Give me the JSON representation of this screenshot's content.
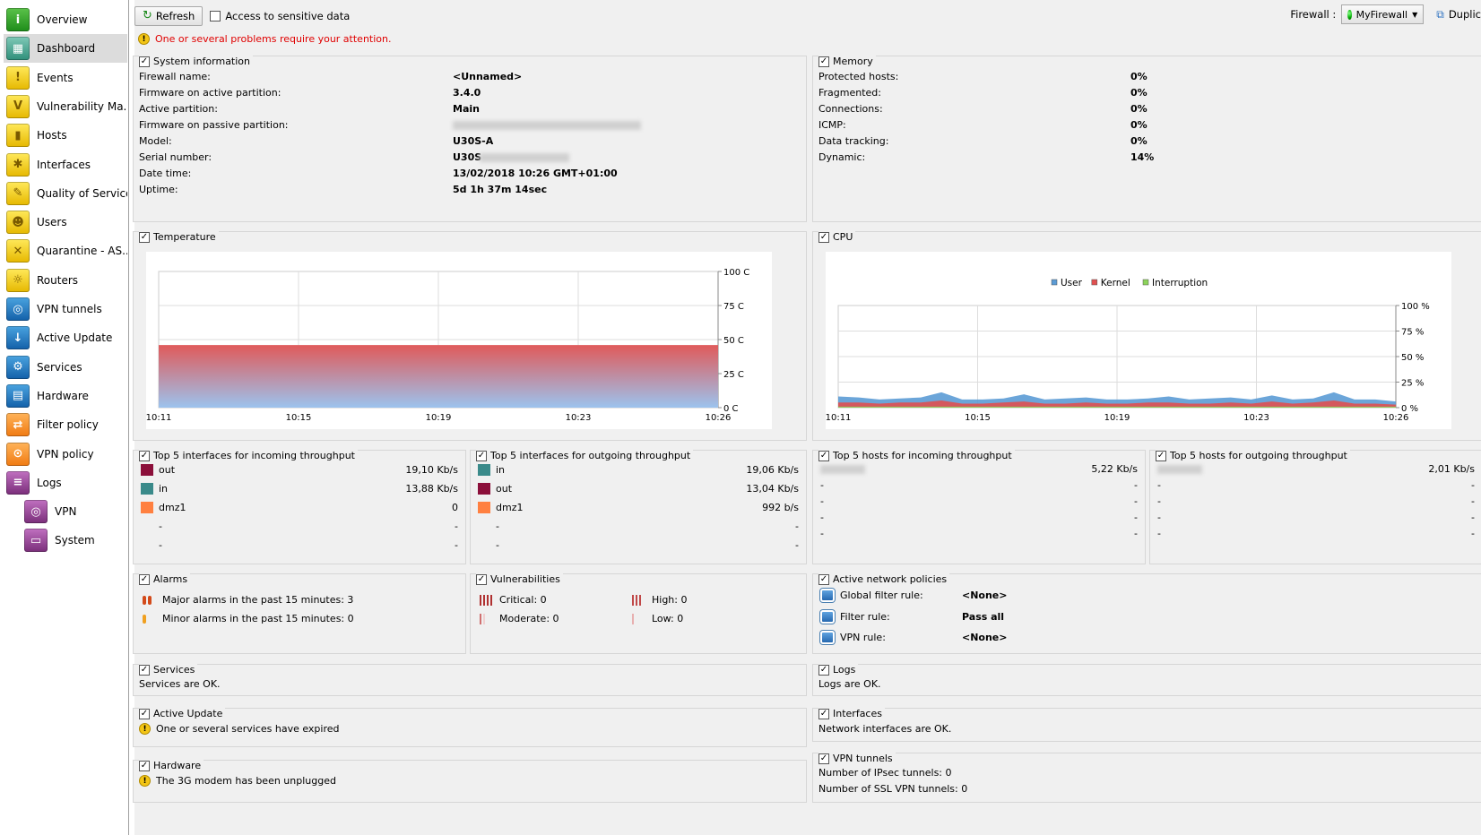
{
  "sidebar": {
    "items": [
      {
        "label": "Overview",
        "icon": "info-icon",
        "color": "green"
      },
      {
        "label": "Dashboard",
        "icon": "dashboard-icon",
        "color": "teal",
        "active": true
      },
      {
        "label": "Events",
        "icon": "warning-icon",
        "color": "yellow"
      },
      {
        "label": "Vulnerability Ma...",
        "icon": "shield-icon",
        "color": "yellow"
      },
      {
        "label": "Hosts",
        "icon": "host-icon",
        "color": "yellow"
      },
      {
        "label": "Interfaces",
        "icon": "interface-icon",
        "color": "yellow"
      },
      {
        "label": "Quality of Service",
        "icon": "qos-icon",
        "color": "yellow"
      },
      {
        "label": "Users",
        "icon": "users-icon",
        "color": "yellow"
      },
      {
        "label": "Quarantine - AS...",
        "icon": "quarantine-icon",
        "color": "yellow"
      },
      {
        "label": "Routers",
        "icon": "router-icon",
        "color": "yellow"
      },
      {
        "label": "VPN tunnels",
        "icon": "vpn-icon",
        "color": "blue"
      },
      {
        "label": "Active Update",
        "icon": "update-icon",
        "color": "blue"
      },
      {
        "label": "Services",
        "icon": "gear-icon",
        "color": "blue"
      },
      {
        "label": "Hardware",
        "icon": "hardware-icon",
        "color": "blue"
      },
      {
        "label": "Filter policy",
        "icon": "filter-icon",
        "color": "orange"
      },
      {
        "label": "VPN policy",
        "icon": "vpn-policy-icon",
        "color": "orange"
      },
      {
        "label": "Logs",
        "icon": "logs-icon",
        "color": "purple"
      },
      {
        "label": "VPN",
        "icon": "vpn-log-icon",
        "color": "purple",
        "sub": true
      },
      {
        "label": "System",
        "icon": "system-log-icon",
        "color": "purple",
        "sub": true
      }
    ]
  },
  "toolbar": {
    "refresh": "Refresh",
    "sensitive": "Access to sensitive data",
    "firewall_label": "Firewall :",
    "firewall_value": "MyFirewall",
    "duplicate": "Duplic"
  },
  "alert": "One or several problems require your attention.",
  "sysinfo": {
    "title": "System information",
    "rows": [
      {
        "k": "Firewall name:",
        "v": "<Unnamed>"
      },
      {
        "k": "Firmware on active partition:",
        "v": "3.4.0"
      },
      {
        "k": "Active partition:",
        "v": "Main"
      },
      {
        "k": "Firmware on passive partition:",
        "v": ""
      },
      {
        "k": "Model:",
        "v": "U30S-A"
      },
      {
        "k": "Serial number:",
        "v": "U30S"
      },
      {
        "k": "Date time:",
        "v": "13/02/2018 10:26 GMT+01:00"
      },
      {
        "k": "Uptime:",
        "v": "5d 1h 37m 14sec"
      }
    ]
  },
  "memory": {
    "title": "Memory",
    "rows": [
      {
        "k": "Protected hosts:",
        "v": "0%"
      },
      {
        "k": "Fragmented:",
        "v": "0%"
      },
      {
        "k": "Connections:",
        "v": "0%"
      },
      {
        "k": "ICMP:",
        "v": "0%"
      },
      {
        "k": "Data tracking:",
        "v": "0%"
      },
      {
        "k": "Dynamic:",
        "v": "14%"
      }
    ]
  },
  "temperature": {
    "title": "Temperature"
  },
  "cpu": {
    "title": "CPU"
  },
  "chart_data": [
    {
      "type": "area",
      "title": "",
      "x": [
        "10:11",
        "10:15",
        "10:19",
        "10:23",
        "10:26"
      ],
      "y_ticks": [
        "100 C",
        "75 C",
        "50 C",
        "25 C",
        "0 C"
      ],
      "ylim": [
        0,
        100
      ],
      "series": [
        {
          "values": [
            46,
            46,
            46,
            46,
            46
          ]
        }
      ]
    },
    {
      "type": "area",
      "title": "",
      "x": [
        "10:11",
        "10:15",
        "10:19",
        "10:23",
        "10:26"
      ],
      "y_ticks": [
        "100 %",
        "75 %",
        "50 %",
        "25 %",
        "0 %"
      ],
      "ylim": [
        0,
        100
      ],
      "legend_position": "top",
      "series": [
        {
          "name": "User",
          "color": "#5b9bd5",
          "values": [
            11,
            10,
            8,
            9,
            10,
            15,
            8,
            8,
            9,
            13,
            8,
            9,
            10,
            8,
            8,
            9,
            11,
            8,
            9,
            10,
            8,
            12,
            8,
            9,
            15,
            8,
            8,
            6
          ]
        },
        {
          "name": "Kernel",
          "color": "#e05050",
          "values": [
            5,
            5,
            4,
            5,
            5,
            7,
            4,
            4,
            5,
            6,
            4,
            4,
            5,
            4,
            4,
            5,
            5,
            4,
            4,
            5,
            4,
            6,
            4,
            5,
            7,
            4,
            4,
            3
          ]
        },
        {
          "name": "Interruption",
          "color": "#8cd35a",
          "values": [
            1,
            1,
            1,
            1,
            1,
            1,
            1,
            1,
            1,
            1,
            1,
            1,
            1,
            1,
            1,
            1,
            1,
            1,
            1,
            1,
            1,
            1,
            1,
            1,
            1,
            1,
            1,
            1
          ]
        }
      ]
    }
  ],
  "tiin": {
    "title": "Top 5 interfaces for incoming throughput",
    "rows": [
      {
        "name": "out",
        "val": "19,10 Kb/s",
        "color": "#8b0f3a"
      },
      {
        "name": "in",
        "val": "13,88 Kb/s",
        "color": "#3a8a8a"
      },
      {
        "name": "dmz1",
        "val": "0",
        "color": "#ff8040"
      },
      {
        "name": "-",
        "val": "-"
      },
      {
        "name": "-",
        "val": "-"
      }
    ]
  },
  "tiout": {
    "title": "Top 5 interfaces for outgoing throughput",
    "rows": [
      {
        "name": "in",
        "val": "19,06 Kb/s",
        "color": "#3a8a8a"
      },
      {
        "name": "out",
        "val": "13,04 Kb/s",
        "color": "#8b0f3a"
      },
      {
        "name": "dmz1",
        "val": "992 b/s",
        "color": "#ff8040"
      },
      {
        "name": "-",
        "val": "-"
      },
      {
        "name": "-",
        "val": "-"
      }
    ]
  },
  "thin": {
    "title": "Top 5 hosts for incoming throughput",
    "rows": [
      {
        "name": "",
        "val": "5,22 Kb/s"
      },
      {
        "name": "-",
        "val": "-"
      },
      {
        "name": "-",
        "val": "-"
      },
      {
        "name": "-",
        "val": "-"
      },
      {
        "name": "-",
        "val": "-"
      }
    ]
  },
  "thout": {
    "title": "Top 5 hosts for outgoing throughput",
    "rows": [
      {
        "name": "",
        "val": "2,01 Kb/s"
      },
      {
        "name": "-",
        "val": "-"
      },
      {
        "name": "-",
        "val": "-"
      },
      {
        "name": "-",
        "val": "-"
      },
      {
        "name": "-",
        "val": "-"
      }
    ]
  },
  "alarms": {
    "title": "Alarms",
    "major": "Major alarms in the past 15 minutes: 3",
    "minor": "Minor alarms in the past 15 minutes: 0"
  },
  "vuln": {
    "title": "Vulnerabilities",
    "critical": "Critical: 0",
    "high": "High: 0",
    "moderate": "Moderate: 0",
    "low": "Low: 0"
  },
  "policies": {
    "title": "Active network policies",
    "rows": [
      {
        "k": "Global filter rule:",
        "v": "<None>"
      },
      {
        "k": "Filter rule:",
        "v": "Pass all"
      },
      {
        "k": "VPN rule:",
        "v": "<None>"
      }
    ]
  },
  "services": {
    "title": "Services",
    "text": "Services are OK."
  },
  "logs": {
    "title": "Logs",
    "text": "Logs are OK."
  },
  "activeupdate": {
    "title": "Active Update",
    "text": "One or several services have expired"
  },
  "interfaces": {
    "title": "Interfaces",
    "text": "Network interfaces are OK."
  },
  "hardware": {
    "title": "Hardware",
    "text": "The 3G modem has been unplugged"
  },
  "vpntunnels": {
    "title": "VPN tunnels",
    "ipsec": "Number of IPsec tunnels: 0",
    "ssl": "Number of SSL VPN tunnels: 0"
  }
}
